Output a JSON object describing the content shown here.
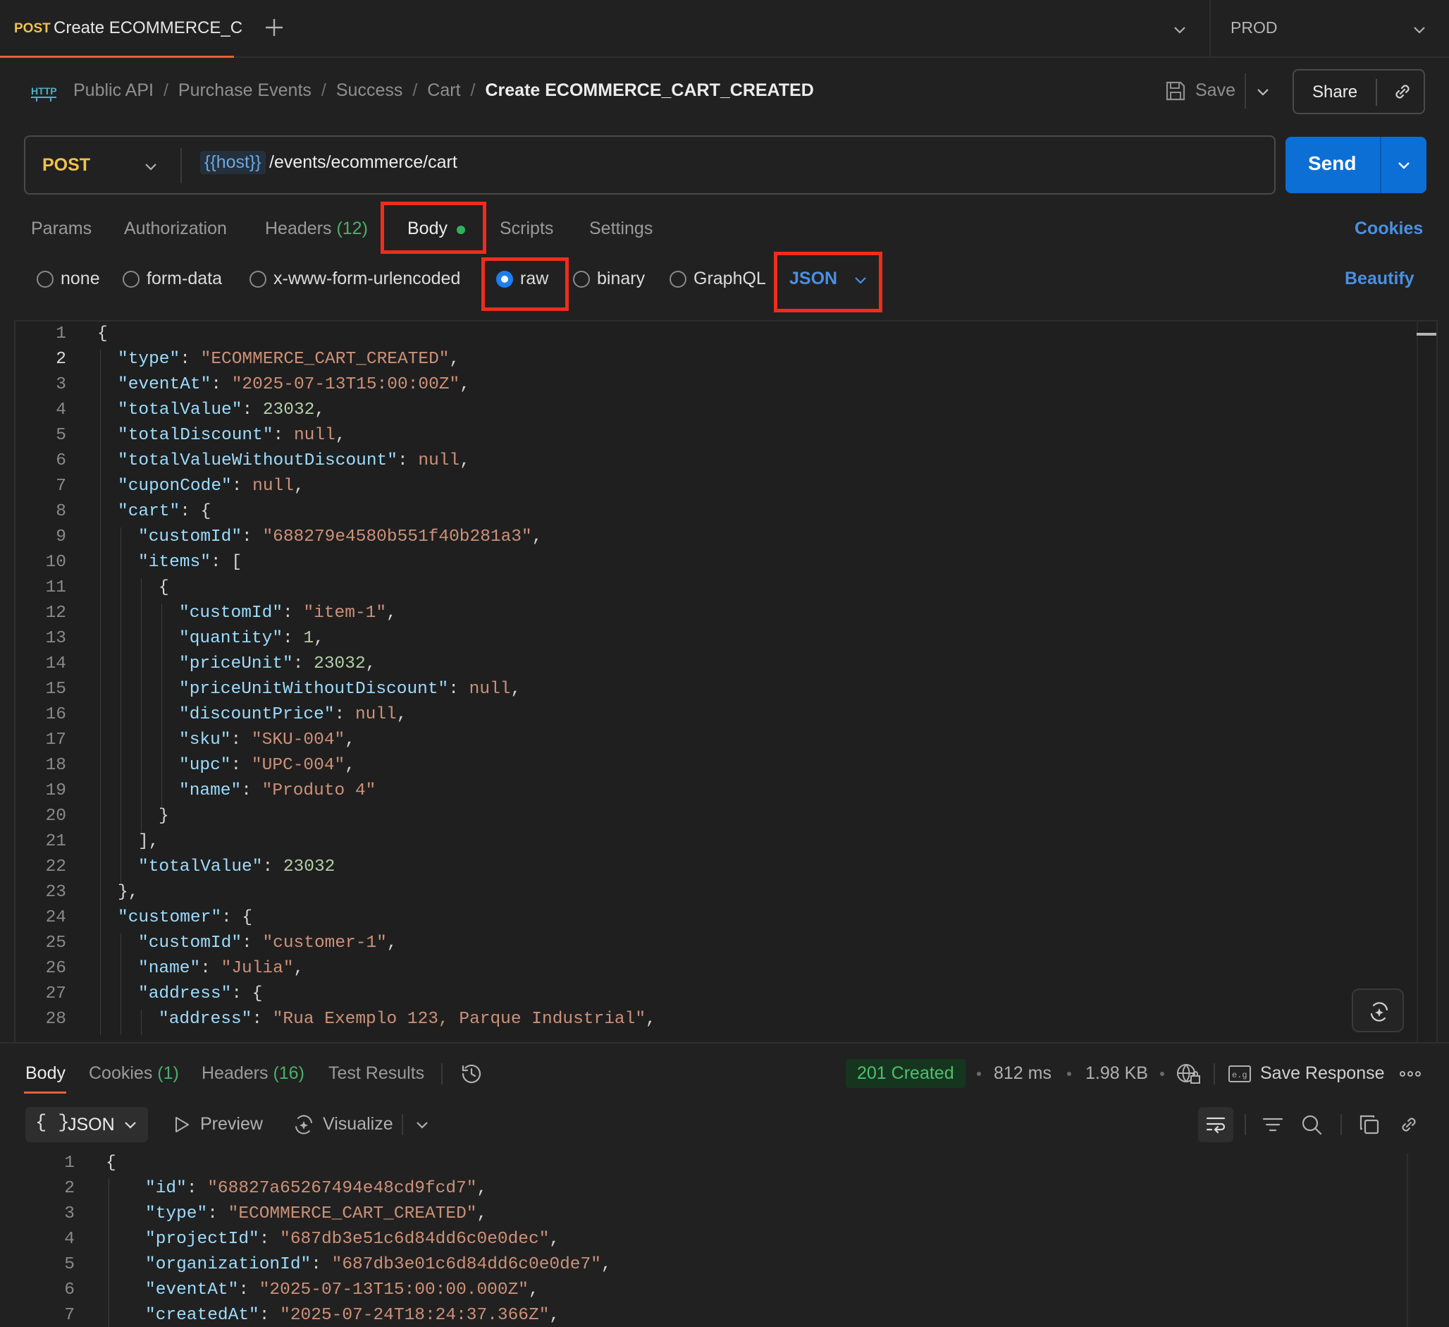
{
  "tab": {
    "method": "POST",
    "title": "Create ECOMMERCE_C"
  },
  "environment": "PROD",
  "breadcrumb": [
    "Public API",
    "Purchase Events",
    "Success",
    "Cart",
    "Create ECOMMERCE_CART_CREATED"
  ],
  "toolbar": {
    "save_label": "Save",
    "share_label": "Share"
  },
  "request": {
    "method": "POST",
    "url_host_var": "{{host}}",
    "url_path": "/events/ecommerce/cart",
    "send_label": "Send"
  },
  "request_tabs": {
    "params": "Params",
    "authorization": "Authorization",
    "headers": "Headers",
    "headers_count": "(12)",
    "body": "Body",
    "scripts": "Scripts",
    "settings": "Settings",
    "cookies": "Cookies"
  },
  "body_types": {
    "none": "none",
    "form_data": "form-data",
    "urlencoded": "x-www-form-urlencoded",
    "raw": "raw",
    "binary": "binary",
    "graphql": "GraphQL",
    "selected": "raw",
    "language": "JSON",
    "beautify": "Beautify"
  },
  "editor_lines": [
    [
      [
        "p",
        "{"
      ]
    ],
    [
      [
        "k",
        "\"type\""
      ],
      [
        "p",
        ": "
      ],
      [
        "s",
        "\"ECOMMERCE_CART_CREATED\""
      ],
      [
        "p",
        ","
      ]
    ],
    [
      [
        "k",
        "\"eventAt\""
      ],
      [
        "p",
        ": "
      ],
      [
        "s",
        "\"2025-07-13T15:00:00Z\""
      ],
      [
        "p",
        ","
      ]
    ],
    [
      [
        "k",
        "\"totalValue\""
      ],
      [
        "p",
        ": "
      ],
      [
        "n",
        "23032"
      ],
      [
        "p",
        ","
      ]
    ],
    [
      [
        "k",
        "\"totalDiscount\""
      ],
      [
        "p",
        ": "
      ],
      [
        "l",
        "null"
      ],
      [
        "p",
        ","
      ]
    ],
    [
      [
        "k",
        "\"totalValueWithoutDiscount\""
      ],
      [
        "p",
        ": "
      ],
      [
        "l",
        "null"
      ],
      [
        "p",
        ","
      ]
    ],
    [
      [
        "k",
        "\"cuponCode\""
      ],
      [
        "p",
        ": "
      ],
      [
        "l",
        "null"
      ],
      [
        "p",
        ","
      ]
    ],
    [
      [
        "k",
        "\"cart\""
      ],
      [
        "p",
        ": {"
      ]
    ],
    [
      [
        "k",
        "\"customId\""
      ],
      [
        "p",
        ": "
      ],
      [
        "s",
        "\"688279e4580b551f40b281a3\""
      ],
      [
        "p",
        ","
      ]
    ],
    [
      [
        "k",
        "\"items\""
      ],
      [
        "p",
        ": ["
      ]
    ],
    [
      [
        "p",
        "{"
      ]
    ],
    [
      [
        "k",
        "\"customId\""
      ],
      [
        "p",
        ": "
      ],
      [
        "s",
        "\"item-1\""
      ],
      [
        "p",
        ","
      ]
    ],
    [
      [
        "k",
        "\"quantity\""
      ],
      [
        "p",
        ": "
      ],
      [
        "n",
        "1"
      ],
      [
        "p",
        ","
      ]
    ],
    [
      [
        "k",
        "\"priceUnit\""
      ],
      [
        "p",
        ": "
      ],
      [
        "n",
        "23032"
      ],
      [
        "p",
        ","
      ]
    ],
    [
      [
        "k",
        "\"priceUnitWithoutDiscount\""
      ],
      [
        "p",
        ": "
      ],
      [
        "l",
        "null"
      ],
      [
        "p",
        ","
      ]
    ],
    [
      [
        "k",
        "\"discountPrice\""
      ],
      [
        "p",
        ": "
      ],
      [
        "l",
        "null"
      ],
      [
        "p",
        ","
      ]
    ],
    [
      [
        "k",
        "\"sku\""
      ],
      [
        "p",
        ": "
      ],
      [
        "s",
        "\"SKU-004\""
      ],
      [
        "p",
        ","
      ]
    ],
    [
      [
        "k",
        "\"upc\""
      ],
      [
        "p",
        ": "
      ],
      [
        "s",
        "\"UPC-004\""
      ],
      [
        "p",
        ","
      ]
    ],
    [
      [
        "k",
        "\"name\""
      ],
      [
        "p",
        ": "
      ],
      [
        "s",
        "\"Produto 4\""
      ]
    ],
    [
      [
        "p",
        "}"
      ]
    ],
    [
      [
        "p",
        "],"
      ]
    ],
    [
      [
        "k",
        "\"totalValue\""
      ],
      [
        "p",
        ": "
      ],
      [
        "n",
        "23032"
      ]
    ],
    [
      [
        "p",
        "},"
      ]
    ],
    [
      [
        "k",
        "\"customer\""
      ],
      [
        "p",
        ": {"
      ]
    ],
    [
      [
        "k",
        "\"customId\""
      ],
      [
        "p",
        ": "
      ],
      [
        "s",
        "\"customer-1\""
      ],
      [
        "p",
        ","
      ]
    ],
    [
      [
        "k",
        "\"name\""
      ],
      [
        "p",
        ": "
      ],
      [
        "s",
        "\"Julia\""
      ],
      [
        "p",
        ","
      ]
    ],
    [
      [
        "k",
        "\"address\""
      ],
      [
        "p",
        ": {"
      ]
    ],
    [
      [
        "k",
        "\"address\""
      ],
      [
        "p",
        ": "
      ],
      [
        "s",
        "\"Rua Exemplo 123, Parque Industrial\""
      ],
      [
        "p",
        ","
      ]
    ]
  ],
  "editor_indent": [
    0,
    1,
    1,
    1,
    1,
    1,
    1,
    1,
    2,
    2,
    3,
    4,
    4,
    4,
    4,
    4,
    4,
    4,
    4,
    3,
    2,
    2,
    1,
    1,
    2,
    2,
    2,
    3
  ],
  "response": {
    "tabs": {
      "body": "Body",
      "cookies": "Cookies",
      "cookies_count": "(1)",
      "headers": "Headers",
      "headers_count": "(16)",
      "test_results": "Test Results"
    },
    "status": "201 Created",
    "time": "812 ms",
    "size": "1.98 KB",
    "save_response": "Save Response",
    "format": "JSON",
    "format_braces": "{ }",
    "preview": "Preview",
    "visualize": "Visualize",
    "lines": [
      [
        [
          "p",
          "{"
        ]
      ],
      [
        [
          "k",
          "\"id\""
        ],
        [
          "p",
          ": "
        ],
        [
          "s",
          "\"68827a65267494e48cd9fcd7\""
        ],
        [
          "p",
          ","
        ]
      ],
      [
        [
          "k",
          "\"type\""
        ],
        [
          "p",
          ": "
        ],
        [
          "s",
          "\"ECOMMERCE_CART_CREATED\""
        ],
        [
          "p",
          ","
        ]
      ],
      [
        [
          "k",
          "\"projectId\""
        ],
        [
          "p",
          ": "
        ],
        [
          "s",
          "\"687db3e51c6d84dd6c0e0dec\""
        ],
        [
          "p",
          ","
        ]
      ],
      [
        [
          "k",
          "\"organizationId\""
        ],
        [
          "p",
          ": "
        ],
        [
          "s",
          "\"687db3e01c6d84dd6c0e0de7\""
        ],
        [
          "p",
          ","
        ]
      ],
      [
        [
          "k",
          "\"eventAt\""
        ],
        [
          "p",
          ": "
        ],
        [
          "s",
          "\"2025-07-13T15:00:00.000Z\""
        ],
        [
          "p",
          ","
        ]
      ],
      [
        [
          "k",
          "\"createdAt\""
        ],
        [
          "p",
          ": "
        ],
        [
          "s",
          "\"2025-07-24T18:24:37.366Z\""
        ],
        [
          "p",
          ","
        ]
      ]
    ],
    "indent": [
      0,
      1,
      1,
      1,
      1,
      1,
      1
    ]
  },
  "colors": {
    "accent_orange": "#e8603c",
    "method_yellow": "#f1c24b",
    "send_blue": "#0b6fd6",
    "link_blue": "#4a90e2",
    "highlight_red": "#ee2d1c",
    "success_green": "#4cc06e"
  }
}
